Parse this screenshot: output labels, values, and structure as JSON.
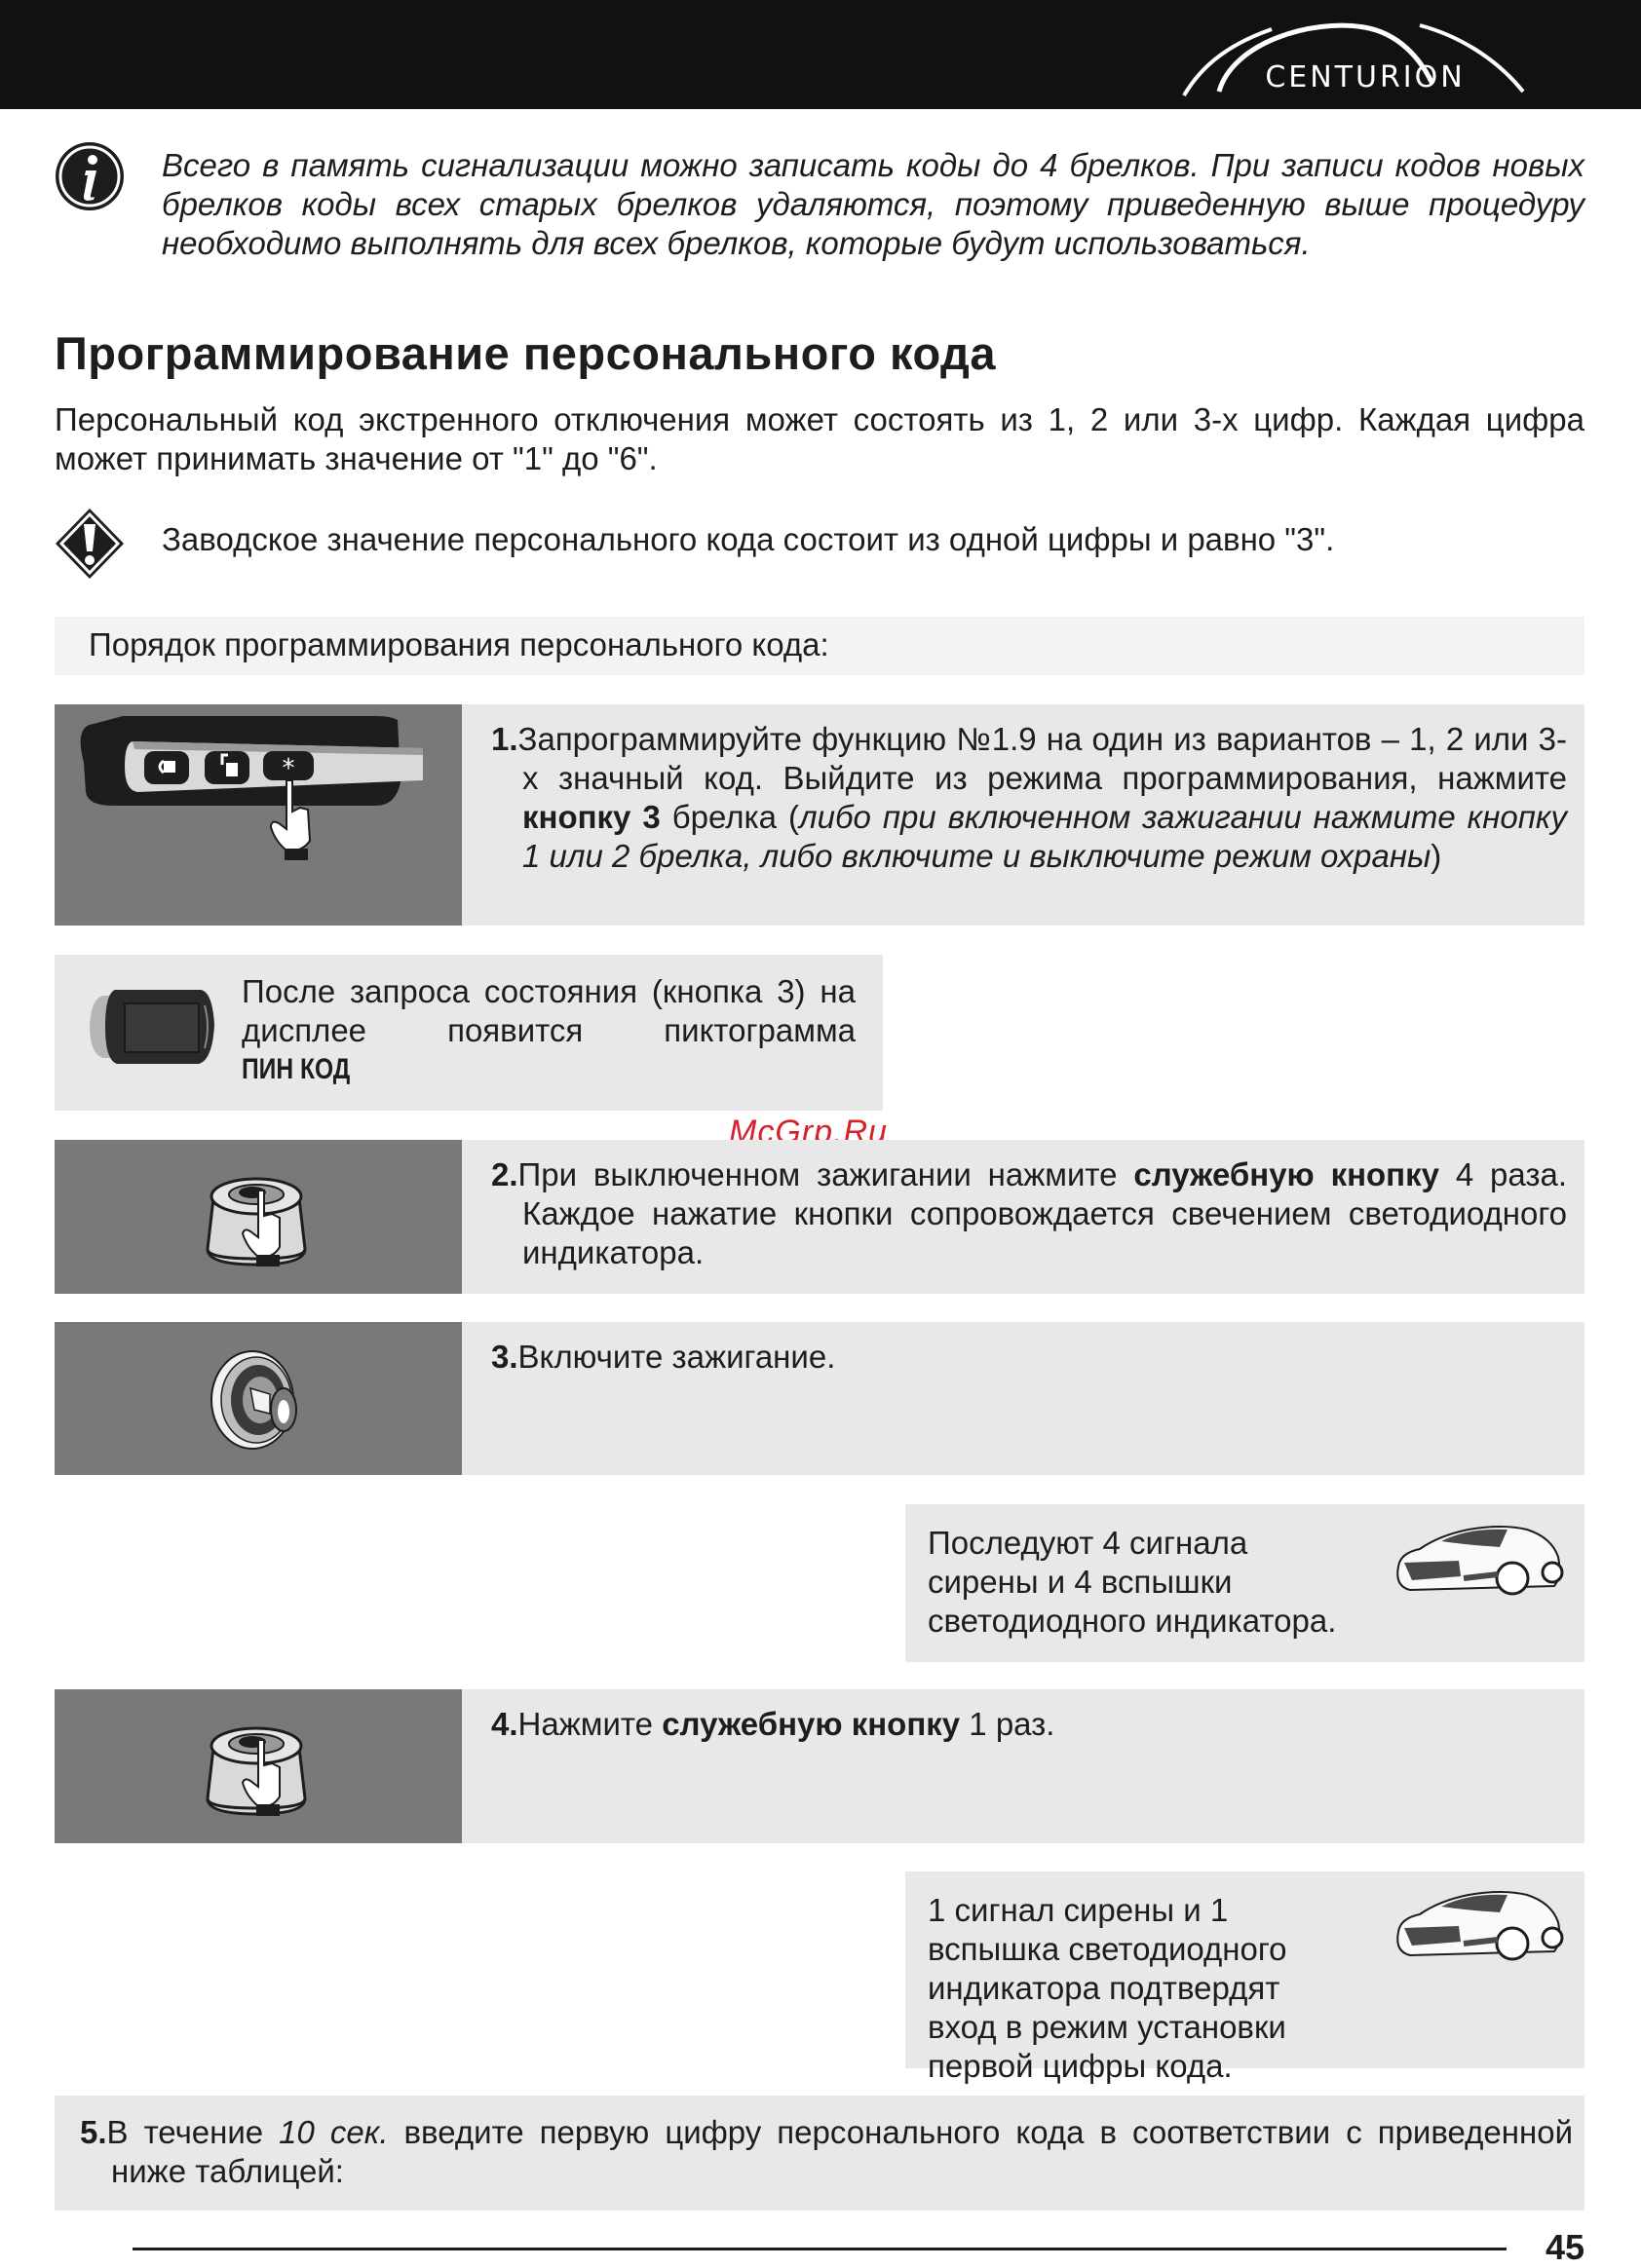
{
  "header": {
    "brand": "CENTURION",
    "background_color": "#12110f"
  },
  "info_note": {
    "icon": "info-icon",
    "text": "Всего в память сигнализации можно записать коды до 4 брелков. При записи кодов новых брелков коды всех старых брелков удаляются, поэтому приведенную выше процедуру необходимо выполнять для всех брелков, которые будут использоваться."
  },
  "section": {
    "title": "Программирование персонального кода",
    "intro": "Персональный код экстренного отключения может состоять из 1, 2 или 3-х цифр. Каждая цифра может принимать значение от \"1\" до \"6\".",
    "warning": {
      "icon": "warning-icon",
      "text": "Заводское значение персонального кода состоит из одной цифры и равно \"3\"."
    },
    "order_heading": "Порядок программирования персонального кода:"
  },
  "steps": [
    {
      "number": "1.",
      "icon": "keyfob-buttons-icon",
      "text_a": "Запрограммируйте функцию №1.9 на один из вариантов – 1, 2 или 3-х значный код. Выйдите из режима программирования, нажмите ",
      "bold": "кнопку 3",
      "text_b": " брелка (",
      "italic": "либо при включенном зажигании нажмите кнопку 1 или 2 брелка, либо включите и выключите режим охраны",
      "text_c": ")"
    },
    {
      "number": "2.",
      "icon": "service-button-icon",
      "text_a": "При выключенном зажигании нажмите ",
      "bold": "служебную кнопку",
      "text_b": " 4 раза. Каждое нажатие кнопки сопровождается свечением светодиодного индикатора."
    },
    {
      "number": "3.",
      "icon": "ignition-key-icon",
      "text_a": "Включите зажигание."
    },
    {
      "number": "4.",
      "icon": "service-button-icon",
      "text_a": "Нажмите ",
      "bold": "служебную кнопку",
      "text_b": " 1 раз."
    },
    {
      "number": "5.",
      "text_a": "В течение ",
      "italic": "10 сек.",
      "text_b": " введите первую цифру персонального кода в соответствии с приведенной ниже таблицей:"
    }
  ],
  "display_note": {
    "icon": "lcd-keyfob-icon",
    "text": "После запроса состояния (кнопка 3) на дисплее появится пиктограмма",
    "pictogram": "ПИН КОД"
  },
  "confirm_notes": [
    {
      "icon": "car-icon",
      "text": "Последуют 4 сигнала сирены и 4 вспышки светодиодного индикатора."
    },
    {
      "icon": "car-icon",
      "text": "1 сигнал сирены и 1 вспышка светодиодного индикатора подтвердят вход в режим установки первой цифры кода."
    }
  ],
  "watermark": "McGrp.Ru",
  "footer": {
    "page_number": "45"
  }
}
